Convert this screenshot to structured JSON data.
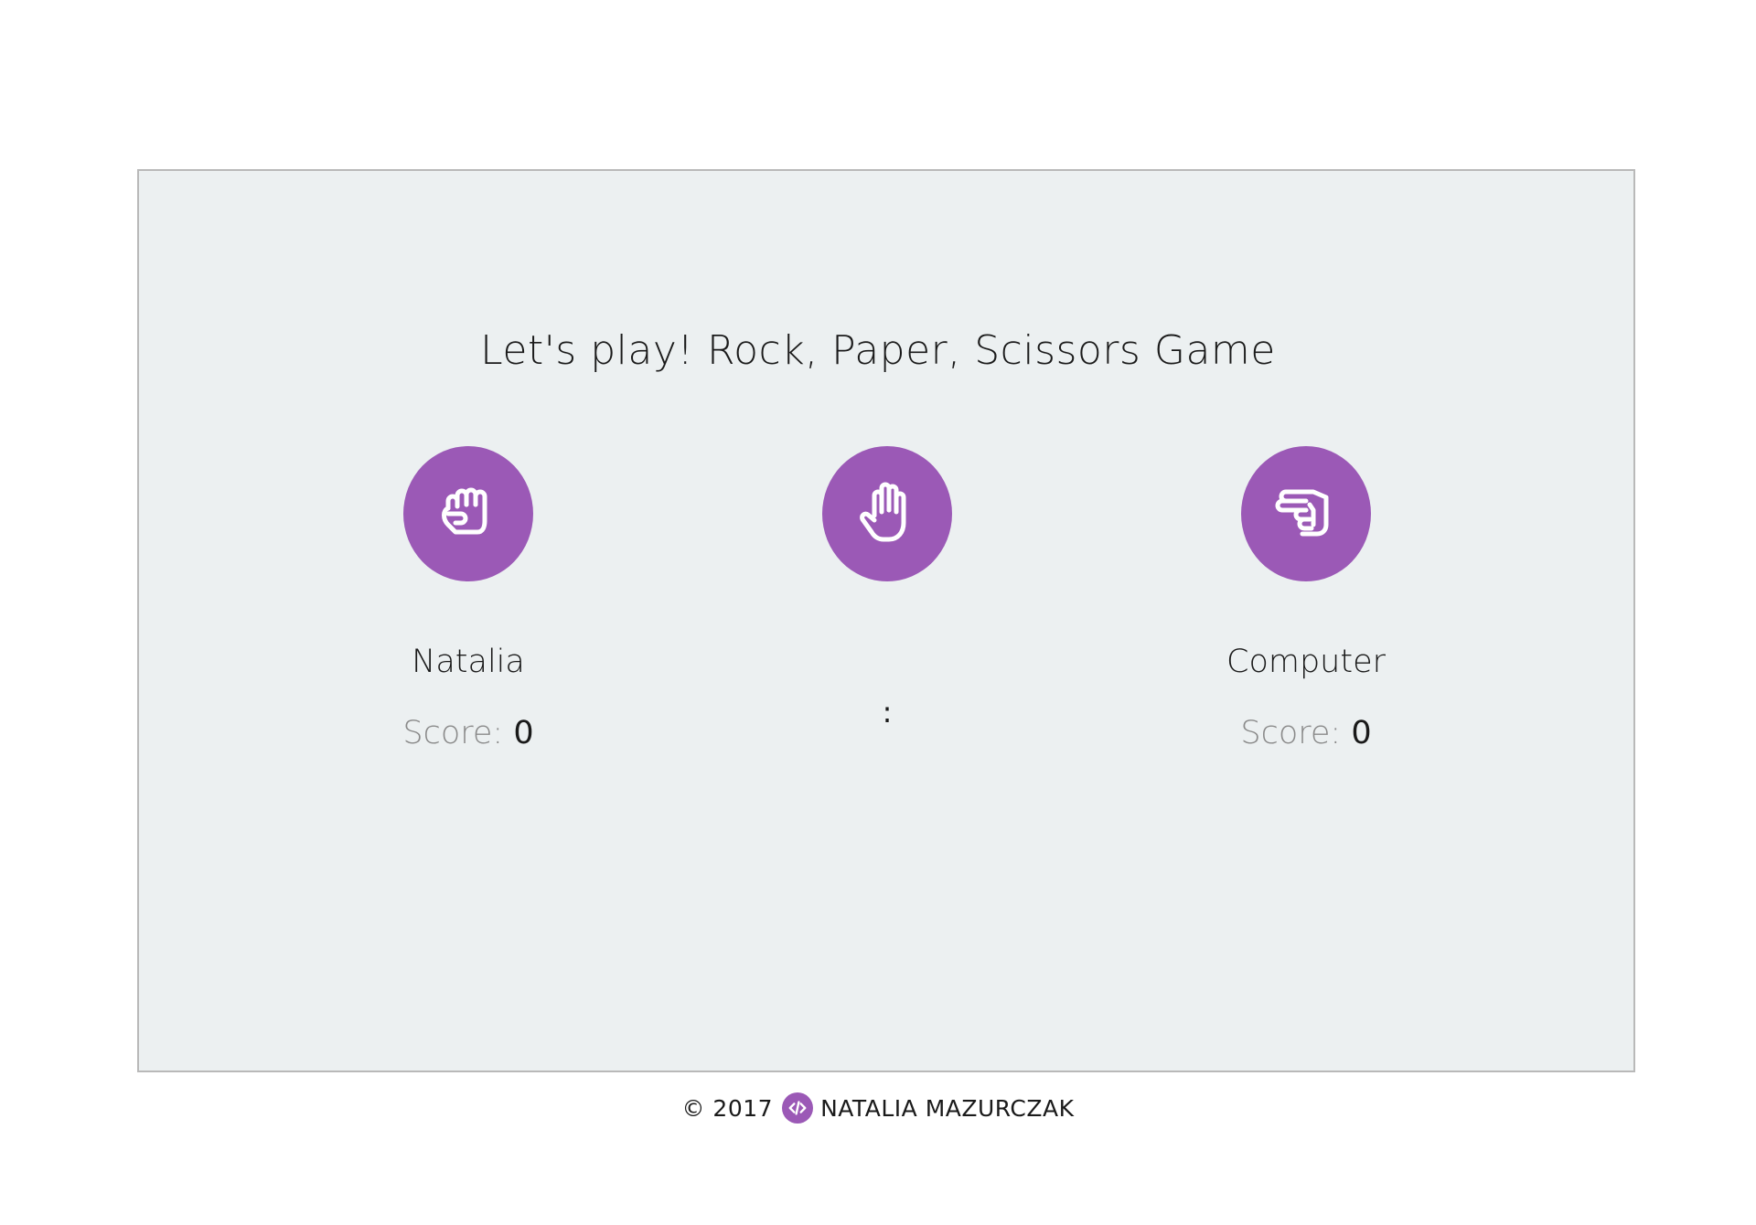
{
  "title": "Let's play! Rock, Paper, Scissors Game",
  "choices": [
    {
      "id": "rock",
      "icon": "fist-rock-icon"
    },
    {
      "id": "paper",
      "icon": "open-hand-paper-icon"
    },
    {
      "id": "scissors",
      "icon": "hand-scissors-icon"
    }
  ],
  "players": {
    "user": {
      "name": "Natalia",
      "score_label": "Score:",
      "score": "0"
    },
    "computer": {
      "name": "Computer",
      "score_label": "Score:",
      "score": "0"
    }
  },
  "result": {
    "separator": ":"
  },
  "footer": {
    "copyright": "© 2017",
    "logo_icon": "code-icon",
    "author": "NATALIA MAZURCZAK"
  },
  "colors": {
    "accent": "#9b59b6",
    "panel_bg": "#ecf0f1",
    "panel_border": "#b9b9b9",
    "text": "#1a1a1a",
    "muted_text": "#8a8a8a"
  }
}
